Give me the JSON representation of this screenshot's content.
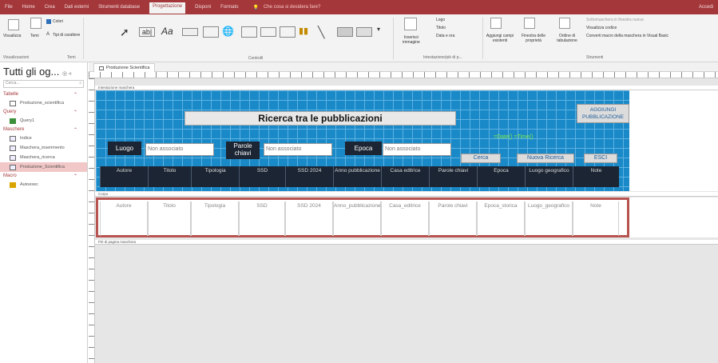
{
  "menubar": {
    "tabs": [
      "File",
      "Home",
      "Crea",
      "Dati esterni",
      "Strumenti database",
      "Progettazione",
      "Disponi",
      "Formato"
    ],
    "active": "Progettazione",
    "tell": "Che cosa si desidera fare?",
    "user": "Accedi"
  },
  "ribbon": {
    "visualizza": "Visualizza",
    "temi_label": "Temi",
    "colori": "Colori",
    "tipi_carattere": "Tipi di carattere",
    "group_visualizzazioni": "Visualizzazioni",
    "group_temi": "Temi",
    "group_controlli": "Controlli",
    "inserisci_immagine": "Inserisci immagine",
    "logo": "Logo",
    "titolo": "Titolo",
    "data_ora": "Data e ora",
    "group_intestazione": "Intestazione/piè di p...",
    "aggiungi_campi": "Aggiungi campi esistenti",
    "finestra_proprieta": "Finestra delle proprietà",
    "ordine_tab": "Ordine di tabulazione",
    "sottomaschera": "Sottomaschera in finestra nuova",
    "visualizza_codice": "Visualizza codice",
    "converti_macro": "Converti macro della maschera in Visual Basic",
    "group_strumenti": "Strumenti"
  },
  "nav": {
    "title": "Tutti gli og...",
    "search_placeholder": "Cerca...",
    "sections": [
      {
        "name": "Tabelle",
        "items": [
          "Produzione_scientifica"
        ]
      },
      {
        "name": "Query",
        "items": [
          "Query1"
        ]
      },
      {
        "name": "Maschere",
        "items": [
          "Indice",
          "Maschera_inserimento",
          "Maschera_ricerca",
          "Produzione_Scientifica"
        ]
      },
      {
        "name": "Macro",
        "items": [
          "Autoexec"
        ]
      }
    ],
    "selected": "Produzione_Scientifica"
  },
  "doc_tab": "Produzione Scientifica",
  "bands": {
    "header": "Intestazione maschera",
    "detail": "Corpo",
    "footer": "Piè di pagina maschera"
  },
  "form": {
    "title": "Ricerca tra le pubblicazioni",
    "add_button": "AGGIUNGI PUBBLICAZIONE",
    "formula": "=Date()  =Time()",
    "luogo_label": "Luogo",
    "parole_label": "Parole chiavi",
    "epoca_label": "Epoca",
    "unbound": "Non associato",
    "cerca": "Cerca",
    "nuova_ricerca": "Nuova Ricerca",
    "esci": "ESCI"
  },
  "columns": [
    {
      "header": "Autore",
      "field": "Autore"
    },
    {
      "header": "Titolo",
      "field": "Titolo"
    },
    {
      "header": "Tipologia",
      "field": "Tipologia"
    },
    {
      "header": "SSD",
      "field": "SSD"
    },
    {
      "header": "SSD 2024",
      "field": "SSD 2024"
    },
    {
      "header": "Anno pubblicazione",
      "field": "Anno_pubblicazione"
    },
    {
      "header": "Casa editrice",
      "field": "Casa_editrice"
    },
    {
      "header": "Parole chiavi",
      "field": "Parole chiavi"
    },
    {
      "header": "Epoca",
      "field": "Epoca_storica"
    },
    {
      "header": "Luogo geografico",
      "field": "Luogo_geografico"
    },
    {
      "header": "Note",
      "field": "Note"
    }
  ],
  "colors": {
    "accent": "#a4373a",
    "form_bg": "#1a89c8",
    "dark": "#1b2533",
    "detail_border": "#b85450",
    "formula": "#7fea4d"
  }
}
